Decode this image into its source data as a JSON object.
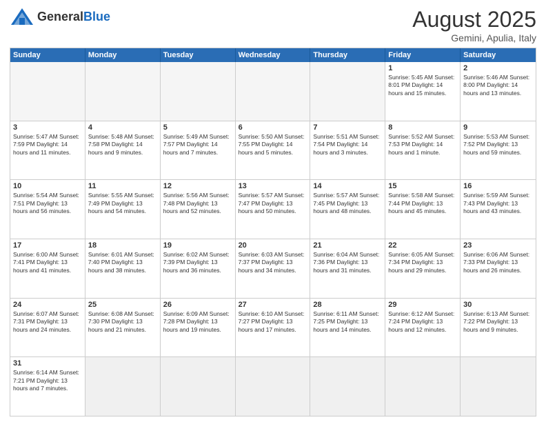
{
  "header": {
    "logo_general": "General",
    "logo_blue": "Blue",
    "month_year": "August 2025",
    "location": "Gemini, Apulia, Italy"
  },
  "weekdays": [
    "Sunday",
    "Monday",
    "Tuesday",
    "Wednesday",
    "Thursday",
    "Friday",
    "Saturday"
  ],
  "rows": [
    [
      {
        "day": "",
        "info": ""
      },
      {
        "day": "",
        "info": ""
      },
      {
        "day": "",
        "info": ""
      },
      {
        "day": "",
        "info": ""
      },
      {
        "day": "",
        "info": ""
      },
      {
        "day": "1",
        "info": "Sunrise: 5:45 AM\nSunset: 8:01 PM\nDaylight: 14 hours and 15 minutes."
      },
      {
        "day": "2",
        "info": "Sunrise: 5:46 AM\nSunset: 8:00 PM\nDaylight: 14 hours and 13 minutes."
      }
    ],
    [
      {
        "day": "3",
        "info": "Sunrise: 5:47 AM\nSunset: 7:59 PM\nDaylight: 14 hours and 11 minutes."
      },
      {
        "day": "4",
        "info": "Sunrise: 5:48 AM\nSunset: 7:58 PM\nDaylight: 14 hours and 9 minutes."
      },
      {
        "day": "5",
        "info": "Sunrise: 5:49 AM\nSunset: 7:57 PM\nDaylight: 14 hours and 7 minutes."
      },
      {
        "day": "6",
        "info": "Sunrise: 5:50 AM\nSunset: 7:55 PM\nDaylight: 14 hours and 5 minutes."
      },
      {
        "day": "7",
        "info": "Sunrise: 5:51 AM\nSunset: 7:54 PM\nDaylight: 14 hours and 3 minutes."
      },
      {
        "day": "8",
        "info": "Sunrise: 5:52 AM\nSunset: 7:53 PM\nDaylight: 14 hours and 1 minute."
      },
      {
        "day": "9",
        "info": "Sunrise: 5:53 AM\nSunset: 7:52 PM\nDaylight: 13 hours and 59 minutes."
      }
    ],
    [
      {
        "day": "10",
        "info": "Sunrise: 5:54 AM\nSunset: 7:51 PM\nDaylight: 13 hours and 56 minutes."
      },
      {
        "day": "11",
        "info": "Sunrise: 5:55 AM\nSunset: 7:49 PM\nDaylight: 13 hours and 54 minutes."
      },
      {
        "day": "12",
        "info": "Sunrise: 5:56 AM\nSunset: 7:48 PM\nDaylight: 13 hours and 52 minutes."
      },
      {
        "day": "13",
        "info": "Sunrise: 5:57 AM\nSunset: 7:47 PM\nDaylight: 13 hours and 50 minutes."
      },
      {
        "day": "14",
        "info": "Sunrise: 5:57 AM\nSunset: 7:45 PM\nDaylight: 13 hours and 48 minutes."
      },
      {
        "day": "15",
        "info": "Sunrise: 5:58 AM\nSunset: 7:44 PM\nDaylight: 13 hours and 45 minutes."
      },
      {
        "day": "16",
        "info": "Sunrise: 5:59 AM\nSunset: 7:43 PM\nDaylight: 13 hours and 43 minutes."
      }
    ],
    [
      {
        "day": "17",
        "info": "Sunrise: 6:00 AM\nSunset: 7:41 PM\nDaylight: 13 hours and 41 minutes."
      },
      {
        "day": "18",
        "info": "Sunrise: 6:01 AM\nSunset: 7:40 PM\nDaylight: 13 hours and 38 minutes."
      },
      {
        "day": "19",
        "info": "Sunrise: 6:02 AM\nSunset: 7:39 PM\nDaylight: 13 hours and 36 minutes."
      },
      {
        "day": "20",
        "info": "Sunrise: 6:03 AM\nSunset: 7:37 PM\nDaylight: 13 hours and 34 minutes."
      },
      {
        "day": "21",
        "info": "Sunrise: 6:04 AM\nSunset: 7:36 PM\nDaylight: 13 hours and 31 minutes."
      },
      {
        "day": "22",
        "info": "Sunrise: 6:05 AM\nSunset: 7:34 PM\nDaylight: 13 hours and 29 minutes."
      },
      {
        "day": "23",
        "info": "Sunrise: 6:06 AM\nSunset: 7:33 PM\nDaylight: 13 hours and 26 minutes."
      }
    ],
    [
      {
        "day": "24",
        "info": "Sunrise: 6:07 AM\nSunset: 7:31 PM\nDaylight: 13 hours and 24 minutes."
      },
      {
        "day": "25",
        "info": "Sunrise: 6:08 AM\nSunset: 7:30 PM\nDaylight: 13 hours and 21 minutes."
      },
      {
        "day": "26",
        "info": "Sunrise: 6:09 AM\nSunset: 7:28 PM\nDaylight: 13 hours and 19 minutes."
      },
      {
        "day": "27",
        "info": "Sunrise: 6:10 AM\nSunset: 7:27 PM\nDaylight: 13 hours and 17 minutes."
      },
      {
        "day": "28",
        "info": "Sunrise: 6:11 AM\nSunset: 7:25 PM\nDaylight: 13 hours and 14 minutes."
      },
      {
        "day": "29",
        "info": "Sunrise: 6:12 AM\nSunset: 7:24 PM\nDaylight: 13 hours and 12 minutes."
      },
      {
        "day": "30",
        "info": "Sunrise: 6:13 AM\nSunset: 7:22 PM\nDaylight: 13 hours and 9 minutes."
      }
    ],
    [
      {
        "day": "31",
        "info": "Sunrise: 6:14 AM\nSunset: 7:21 PM\nDaylight: 13 hours and 7 minutes."
      },
      {
        "day": "",
        "info": ""
      },
      {
        "day": "",
        "info": ""
      },
      {
        "day": "",
        "info": ""
      },
      {
        "day": "",
        "info": ""
      },
      {
        "day": "",
        "info": ""
      },
      {
        "day": "",
        "info": ""
      }
    ]
  ]
}
